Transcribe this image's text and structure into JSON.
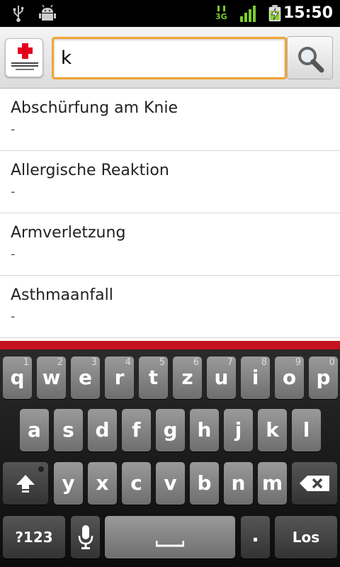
{
  "status_bar": {
    "time": "15:50",
    "network_label": "3G",
    "icons": [
      "usb-icon",
      "android-debug-icon",
      "network-3g-icon",
      "signal-bars-icon",
      "battery-charging-icon"
    ]
  },
  "search": {
    "query": "k",
    "button_icon": "magnifier-icon"
  },
  "list": {
    "items": [
      {
        "title": "Abschürfung am Knie",
        "subtitle": "-"
      },
      {
        "title": "Allergische Reaktion",
        "subtitle": "-"
      },
      {
        "title": "Armverletzung",
        "subtitle": "-"
      },
      {
        "title": "Asthmaanfall",
        "subtitle": "-"
      }
    ]
  },
  "keyboard": {
    "row1": [
      {
        "key": "q",
        "hint": "1"
      },
      {
        "key": "w",
        "hint": "2"
      },
      {
        "key": "e",
        "hint": "3"
      },
      {
        "key": "r",
        "hint": "4"
      },
      {
        "key": "t",
        "hint": "5"
      },
      {
        "key": "z",
        "hint": "6"
      },
      {
        "key": "u",
        "hint": "7"
      },
      {
        "key": "i",
        "hint": "8"
      },
      {
        "key": "o",
        "hint": "9"
      },
      {
        "key": "p",
        "hint": "0"
      }
    ],
    "row2": [
      "a",
      "s",
      "d",
      "f",
      "g",
      "h",
      "j",
      "k",
      "l"
    ],
    "row3": [
      "y",
      "x",
      "c",
      "v",
      "b",
      "n",
      "m"
    ],
    "symbols_label": "?123",
    "period_label": ".",
    "enter_label": "Los"
  }
}
